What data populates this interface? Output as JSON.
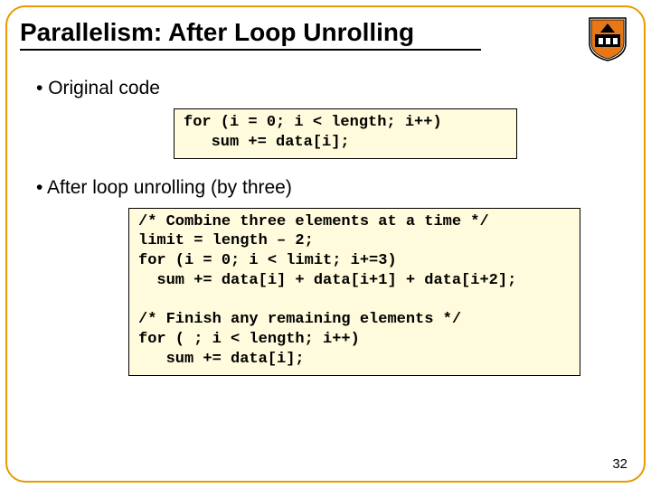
{
  "title": "Parallelism: After Loop Unrolling",
  "bullets": {
    "b1": "Original code",
    "b2": "After loop unrolling (by three)"
  },
  "code": {
    "c1": "for (i = 0; i < length; i++)\n   sum += data[i];",
    "c2": "/* Combine three elements at a time */\nlimit = length – 2;\nfor (i = 0; i < limit; i+=3)\n  sum += data[i] + data[i+1] + data[i+2];\n\n/* Finish any remaining elements */\nfor ( ; i < length; i++)\n   sum += data[i];"
  },
  "page_number": "32"
}
